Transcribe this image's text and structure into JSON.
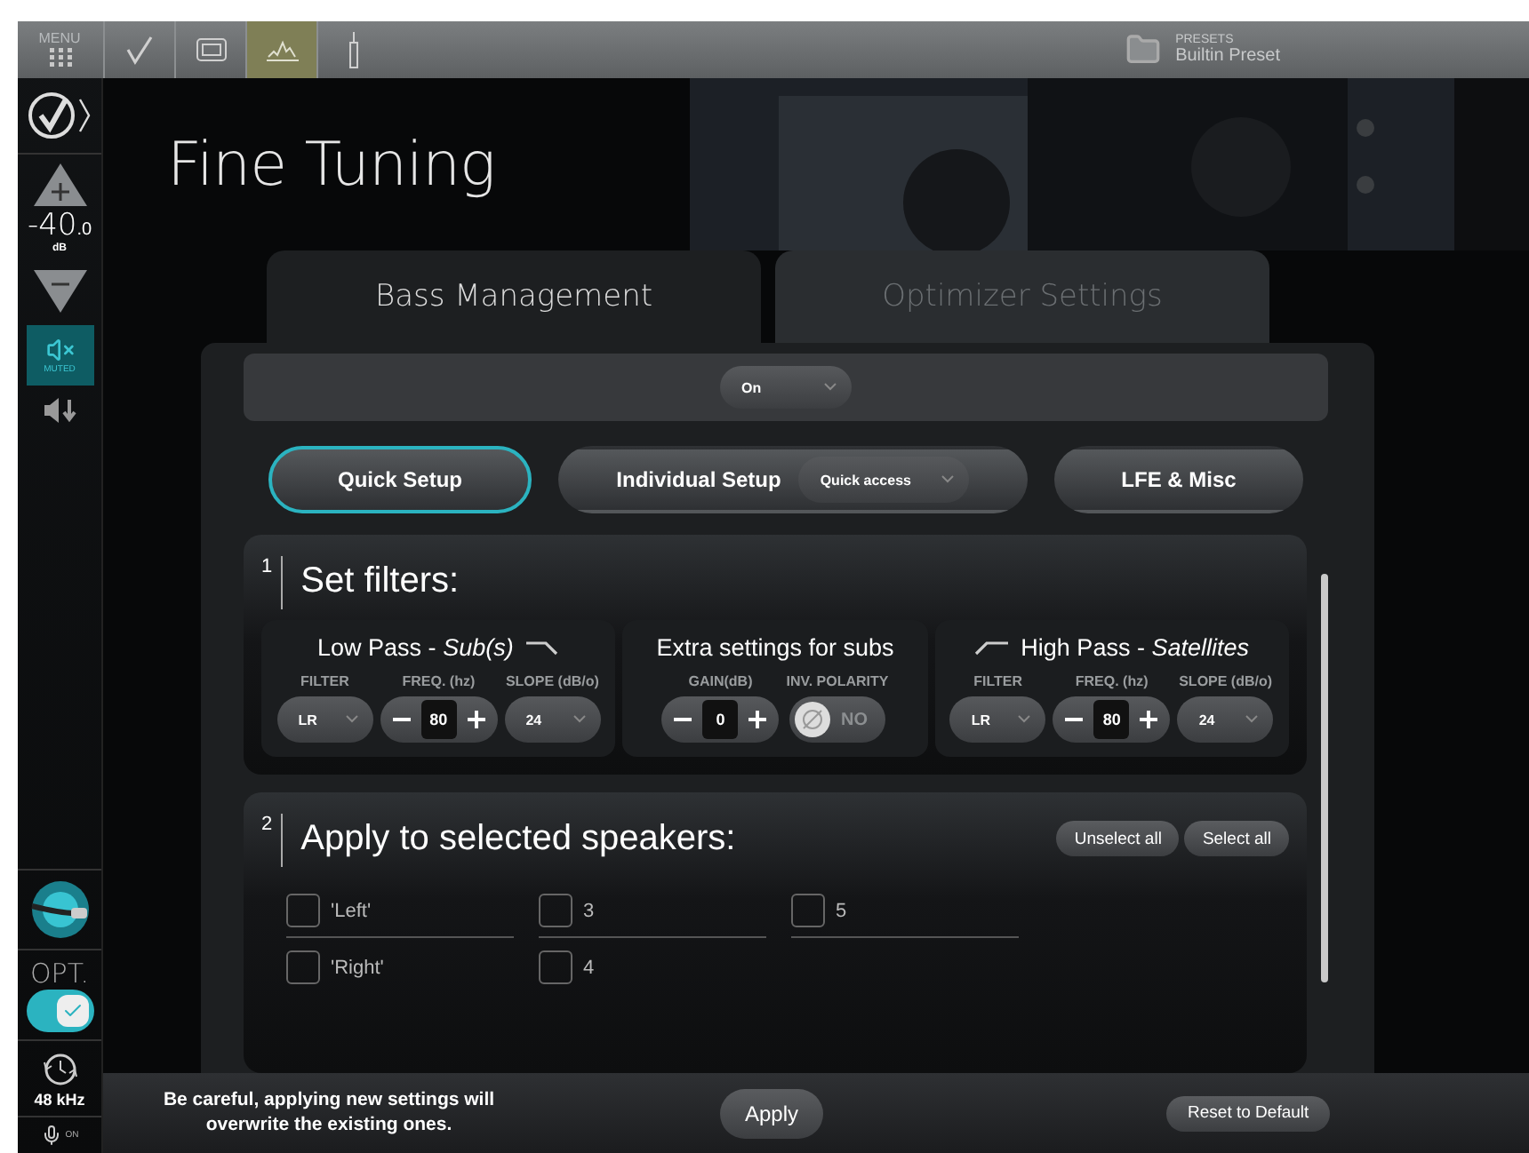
{
  "top_bar": {
    "menu_label": "MENU",
    "tools": [
      {
        "kind": "check",
        "selected": false
      },
      {
        "kind": "screen",
        "selected": false
      },
      {
        "kind": "tuning",
        "selected": true
      },
      {
        "kind": "probe",
        "selected": false
      }
    ],
    "preset": {
      "label": "PRESETS",
      "value": "Builtin Preset"
    }
  },
  "sidebar": {
    "volume": "-40",
    "volume_decimal": ".0",
    "unit": "dB",
    "mute": {
      "label": "MUTED",
      "on": true
    },
    "opt": {
      "label": "OPT.",
      "on": true
    },
    "sample_rate": "48 kHz",
    "mic_label": "ON"
  },
  "page_title": "Fine Tuning",
  "tabs": [
    {
      "label": "Bass Management",
      "selected": true
    },
    {
      "label": "Optimizer Settings",
      "selected": false
    }
  ],
  "mode_select": "On",
  "setup_buttons": [
    {
      "label": "Quick Setup",
      "selected": true
    },
    {
      "label": "Individual Setup",
      "selected": false,
      "dropdown": "Quick access"
    },
    {
      "label": "LFE & Misc",
      "selected": false
    }
  ],
  "filters_section": {
    "number": "1",
    "title": "Set filters:",
    "groups": [
      {
        "title": "Low Pass - *Sub(s)*",
        "kind": "lowpass",
        "fields": [
          {
            "label": "FILTER",
            "kind": "select",
            "value": "LR"
          },
          {
            "label": "FREQ. (hz)",
            "kind": "stepper",
            "value": "80"
          },
          {
            "label": "SLOPE (dB/o)",
            "kind": "select",
            "value": "24"
          }
        ]
      },
      {
        "title": "Extra settings for subs",
        "kind": "extra",
        "fields": [
          {
            "label": "GAIN(dB)",
            "kind": "stepper",
            "value": "0"
          },
          {
            "label": "INV. POLARITY",
            "kind": "toggle",
            "value": "NO",
            "on": false
          }
        ]
      },
      {
        "title": "High Pass - *Satellites*",
        "kind": "highpass",
        "fields": [
          {
            "label": "FILTER",
            "kind": "select",
            "value": "LR"
          },
          {
            "label": "FREQ. (hz)",
            "kind": "stepper",
            "value": "80"
          },
          {
            "label": "SLOPE (dB/o)",
            "kind": "select",
            "value": "24"
          }
        ]
      }
    ]
  },
  "speakers_section": {
    "number": "2",
    "title": "Apply to selected speakers:",
    "buttons": [
      "Unselect all",
      "Select all"
    ],
    "speakers": [
      {
        "label": "'Left'",
        "checked": false
      },
      {
        "label": "3",
        "checked": false
      },
      {
        "label": "5",
        "checked": false
      },
      {
        "label": "'Right'",
        "checked": false
      },
      {
        "label": "4",
        "checked": false
      }
    ]
  },
  "footer": {
    "warning": "Be careful, applying new settings will overwrite the existing ones.",
    "apply": "Apply",
    "reset": "Reset to Default"
  }
}
